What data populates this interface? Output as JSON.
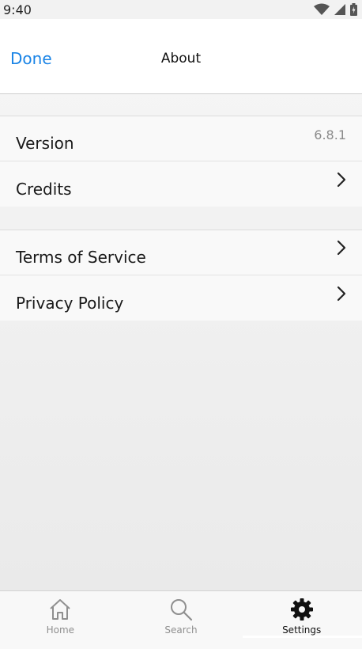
{
  "status_bar": {
    "time": "9:40",
    "icons": [
      "wifi-icon",
      "cell-signal-icon",
      "battery-icon"
    ]
  },
  "nav_bar": {
    "done_label": "Done",
    "title": "About"
  },
  "groups": [
    {
      "rows": [
        {
          "label": "Version",
          "value": "6.8.1"
        },
        {
          "label": "Credits",
          "chevron": true
        }
      ]
    },
    {
      "rows": [
        {
          "label": "Terms of Service",
          "chevron": true
        },
        {
          "label": "Privacy Policy",
          "chevron": true
        }
      ]
    }
  ],
  "tab_bar": {
    "tabs": [
      {
        "label": "Home",
        "icon": "home-icon"
      },
      {
        "label": "Search",
        "icon": "search-icon"
      },
      {
        "label": "Settings",
        "icon": "gear-icon",
        "active": true
      }
    ]
  },
  "colors": {
    "accent": "#1a84e6",
    "text": "#1a1a1a",
    "secondary_text": "#8a8a8a"
  }
}
